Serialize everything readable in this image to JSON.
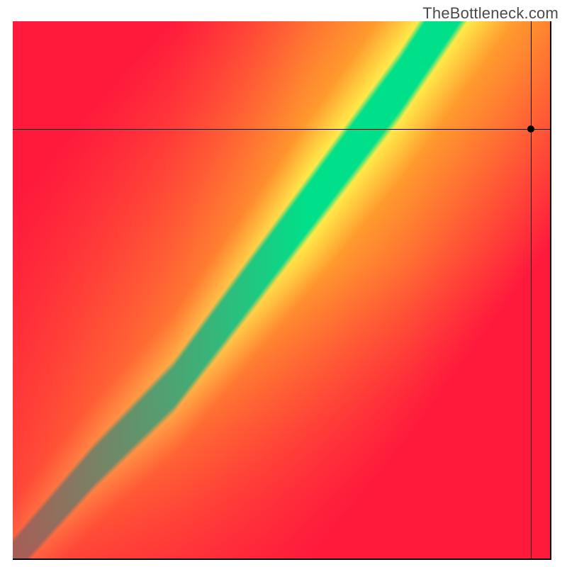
{
  "watermark_text": "TheBottleneck.com",
  "chart_data": {
    "type": "heatmap",
    "title": "",
    "xlabel": "",
    "ylabel": "",
    "xlim": [
      0,
      1
    ],
    "ylim": [
      0,
      1
    ],
    "legend": false,
    "grid": false,
    "crosshair": {
      "x": 0.965,
      "y": 0.8
    },
    "marker": {
      "x": 0.965,
      "y": 0.8
    },
    "green_ridge_breakpoints": [
      {
        "x": 0.0,
        "y": 0.0
      },
      {
        "x": 0.15,
        "y": 0.17
      },
      {
        "x": 0.3,
        "y": 0.32
      },
      {
        "x": 0.45,
        "y": 0.52
      },
      {
        "x": 0.6,
        "y": 0.72
      },
      {
        "x": 0.72,
        "y": 0.88
      },
      {
        "x": 0.8,
        "y": 1.0
      }
    ],
    "ridge_half_width_frac": 0.04,
    "yellow_half_width_frac": 0.11,
    "colors": {
      "optimal": "#00e08a",
      "near": "#ffe94a",
      "warm": "#ff9a2e",
      "bad": "#ff1a3c"
    },
    "description": "Diagonal bottleneck heatmap: green band marks balanced CPU/GPU pairings; color shifts through yellow and orange to red as imbalance grows. Black crosshair and dot mark a queried configuration near the upper-right, outside the green band."
  }
}
